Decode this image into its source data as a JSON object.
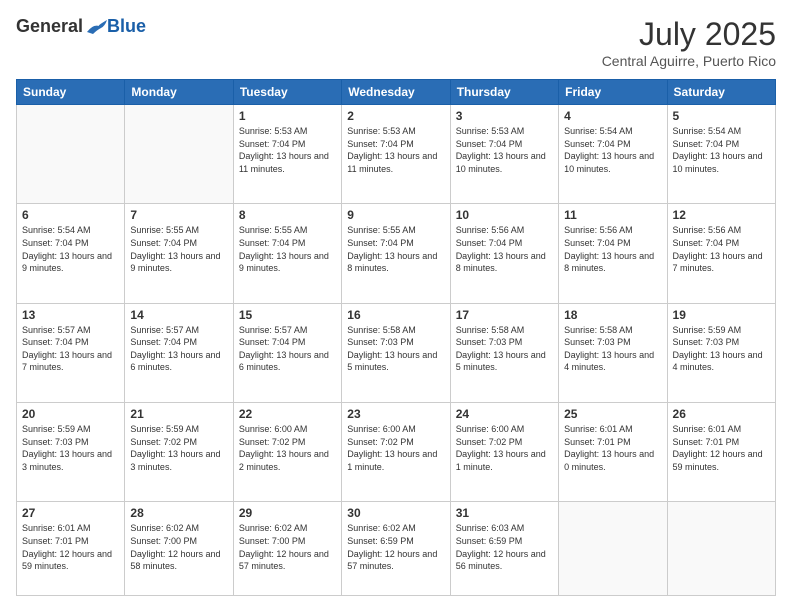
{
  "header": {
    "logo_general": "General",
    "logo_blue": "Blue",
    "month_year": "July 2025",
    "location": "Central Aguirre, Puerto Rico"
  },
  "weekdays": [
    "Sunday",
    "Monday",
    "Tuesday",
    "Wednesday",
    "Thursday",
    "Friday",
    "Saturday"
  ],
  "weeks": [
    [
      {
        "day": "",
        "info": ""
      },
      {
        "day": "",
        "info": ""
      },
      {
        "day": "1",
        "info": "Sunrise: 5:53 AM\nSunset: 7:04 PM\nDaylight: 13 hours and 11 minutes."
      },
      {
        "day": "2",
        "info": "Sunrise: 5:53 AM\nSunset: 7:04 PM\nDaylight: 13 hours and 11 minutes."
      },
      {
        "day": "3",
        "info": "Sunrise: 5:53 AM\nSunset: 7:04 PM\nDaylight: 13 hours and 10 minutes."
      },
      {
        "day": "4",
        "info": "Sunrise: 5:54 AM\nSunset: 7:04 PM\nDaylight: 13 hours and 10 minutes."
      },
      {
        "day": "5",
        "info": "Sunrise: 5:54 AM\nSunset: 7:04 PM\nDaylight: 13 hours and 10 minutes."
      }
    ],
    [
      {
        "day": "6",
        "info": "Sunrise: 5:54 AM\nSunset: 7:04 PM\nDaylight: 13 hours and 9 minutes."
      },
      {
        "day": "7",
        "info": "Sunrise: 5:55 AM\nSunset: 7:04 PM\nDaylight: 13 hours and 9 minutes."
      },
      {
        "day": "8",
        "info": "Sunrise: 5:55 AM\nSunset: 7:04 PM\nDaylight: 13 hours and 9 minutes."
      },
      {
        "day": "9",
        "info": "Sunrise: 5:55 AM\nSunset: 7:04 PM\nDaylight: 13 hours and 8 minutes."
      },
      {
        "day": "10",
        "info": "Sunrise: 5:56 AM\nSunset: 7:04 PM\nDaylight: 13 hours and 8 minutes."
      },
      {
        "day": "11",
        "info": "Sunrise: 5:56 AM\nSunset: 7:04 PM\nDaylight: 13 hours and 8 minutes."
      },
      {
        "day": "12",
        "info": "Sunrise: 5:56 AM\nSunset: 7:04 PM\nDaylight: 13 hours and 7 minutes."
      }
    ],
    [
      {
        "day": "13",
        "info": "Sunrise: 5:57 AM\nSunset: 7:04 PM\nDaylight: 13 hours and 7 minutes."
      },
      {
        "day": "14",
        "info": "Sunrise: 5:57 AM\nSunset: 7:04 PM\nDaylight: 13 hours and 6 minutes."
      },
      {
        "day": "15",
        "info": "Sunrise: 5:57 AM\nSunset: 7:04 PM\nDaylight: 13 hours and 6 minutes."
      },
      {
        "day": "16",
        "info": "Sunrise: 5:58 AM\nSunset: 7:03 PM\nDaylight: 13 hours and 5 minutes."
      },
      {
        "day": "17",
        "info": "Sunrise: 5:58 AM\nSunset: 7:03 PM\nDaylight: 13 hours and 5 minutes."
      },
      {
        "day": "18",
        "info": "Sunrise: 5:58 AM\nSunset: 7:03 PM\nDaylight: 13 hours and 4 minutes."
      },
      {
        "day": "19",
        "info": "Sunrise: 5:59 AM\nSunset: 7:03 PM\nDaylight: 13 hours and 4 minutes."
      }
    ],
    [
      {
        "day": "20",
        "info": "Sunrise: 5:59 AM\nSunset: 7:03 PM\nDaylight: 13 hours and 3 minutes."
      },
      {
        "day": "21",
        "info": "Sunrise: 5:59 AM\nSunset: 7:02 PM\nDaylight: 13 hours and 3 minutes."
      },
      {
        "day": "22",
        "info": "Sunrise: 6:00 AM\nSunset: 7:02 PM\nDaylight: 13 hours and 2 minutes."
      },
      {
        "day": "23",
        "info": "Sunrise: 6:00 AM\nSunset: 7:02 PM\nDaylight: 13 hours and 1 minute."
      },
      {
        "day": "24",
        "info": "Sunrise: 6:00 AM\nSunset: 7:02 PM\nDaylight: 13 hours and 1 minute."
      },
      {
        "day": "25",
        "info": "Sunrise: 6:01 AM\nSunset: 7:01 PM\nDaylight: 13 hours and 0 minutes."
      },
      {
        "day": "26",
        "info": "Sunrise: 6:01 AM\nSunset: 7:01 PM\nDaylight: 12 hours and 59 minutes."
      }
    ],
    [
      {
        "day": "27",
        "info": "Sunrise: 6:01 AM\nSunset: 7:01 PM\nDaylight: 12 hours and 59 minutes."
      },
      {
        "day": "28",
        "info": "Sunrise: 6:02 AM\nSunset: 7:00 PM\nDaylight: 12 hours and 58 minutes."
      },
      {
        "day": "29",
        "info": "Sunrise: 6:02 AM\nSunset: 7:00 PM\nDaylight: 12 hours and 57 minutes."
      },
      {
        "day": "30",
        "info": "Sunrise: 6:02 AM\nSunset: 6:59 PM\nDaylight: 12 hours and 57 minutes."
      },
      {
        "day": "31",
        "info": "Sunrise: 6:03 AM\nSunset: 6:59 PM\nDaylight: 12 hours and 56 minutes."
      },
      {
        "day": "",
        "info": ""
      },
      {
        "day": "",
        "info": ""
      }
    ]
  ]
}
